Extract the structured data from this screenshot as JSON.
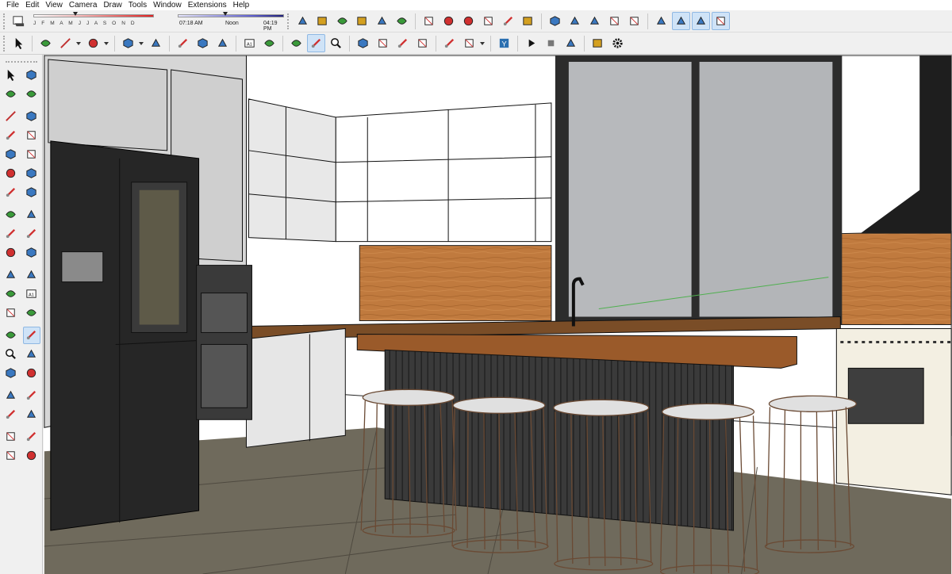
{
  "window": {
    "menu": [
      "File",
      "Edit",
      "View",
      "Camera",
      "Draw",
      "Tools",
      "Window",
      "Extensions",
      "Help"
    ]
  },
  "shadows": {
    "months": "J F M A M J J A S O N D",
    "time_start": "07:18 AM",
    "time_mid": "Noon",
    "time_end": "04:19 PM",
    "date_fraction": 0.35,
    "time_fraction": 0.45
  },
  "toolbars": {
    "top_groups": [
      [
        "iso-view",
        "top-view",
        "front-view",
        "right-view",
        "back-view",
        "left-view"
      ],
      [
        "warehouse-3d",
        "add-location",
        "components",
        "share-model",
        "extension-warehouse",
        "extension-manager"
      ],
      [
        "solid-union",
        "solid-intersect",
        "solid-subtract",
        "solid-trim",
        "solid-split"
      ],
      [
        "axes-tool",
        "section-plane",
        "section-fill",
        "section-display"
      ]
    ],
    "second": [
      "select",
      "eraser",
      "line",
      "arc",
      "circle",
      "push-pull",
      "follow-me",
      "offset",
      "tape-measure",
      "text",
      "paint-bucket",
      "orbit",
      "pan",
      "zoom",
      "zoom-extents",
      "3d-warehouse",
      "extension-warehouse",
      "share",
      "ruby-console",
      "geo-location",
      "layout",
      "play",
      "stop",
      "scene-manager",
      "camera-walk",
      "settings"
    ]
  },
  "left_tools": [
    [
      "select",
      "make-component"
    ],
    [
      "paint-bucket",
      "eraser"
    ],
    [
      "line",
      "freehand"
    ],
    [
      "rectangle",
      "rotated-rectangle"
    ],
    [
      "circle",
      "polygon"
    ],
    [
      "arc",
      "2-point-arc"
    ],
    [
      "3-point-arc",
      "pie"
    ],
    [
      "move",
      "push-pull"
    ],
    [
      "rotate",
      "follow-me"
    ],
    [
      "scale",
      "offset"
    ],
    [
      "tape-measure",
      "dimension"
    ],
    [
      "protractor",
      "text"
    ],
    [
      "axes",
      "3d-text"
    ],
    [
      "orbit",
      "pan"
    ],
    [
      "zoom",
      "zoom-window"
    ],
    [
      "zoom-extents",
      "previous-view"
    ],
    [
      "position-camera",
      "look-around"
    ],
    [
      "walk",
      "section-plane"
    ],
    [
      "3d-warehouse",
      "extension-warehouse"
    ],
    [
      "share-model",
      "ruby"
    ]
  ],
  "colors": {
    "accent": "#1e78c8",
    "wood": "#b8733a",
    "toolbar_bg": "#f0f0f0"
  }
}
